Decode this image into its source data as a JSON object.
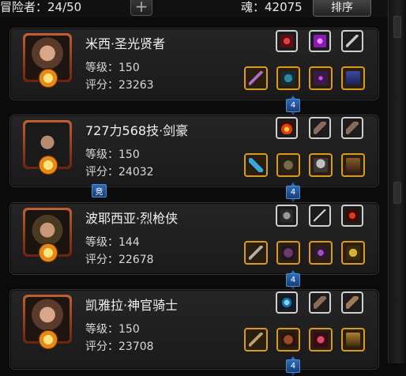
{
  "header": {
    "adventurers_label": "冒险者：24/50",
    "add_symbol": "+",
    "soul_label": "魂：42075",
    "sort_button": "排序"
  },
  "colors": {
    "gold_border": "#d99a1e",
    "white_border": "#cfcfcf",
    "badge_blue": "#2c6ab8"
  },
  "characters": [
    {
      "name": "米西·圣光贤者",
      "level": "等级：150",
      "score": "评分：23263",
      "badge": "4",
      "equipment": [
        {
          "icon": "necklace-icon",
          "frame": "white"
        },
        {
          "icon": "purple-orb-icon",
          "frame": "white"
        },
        {
          "icon": "dagger-icon",
          "frame": "white"
        },
        {
          "icon": "staff-icon",
          "frame": "gold"
        },
        {
          "icon": "armor-icon",
          "frame": "gold"
        },
        {
          "icon": "wand-icon",
          "frame": "gold"
        },
        {
          "icon": "robe-icon",
          "frame": "gold"
        }
      ]
    },
    {
      "name": "727力568技·剑豪",
      "level": "等级：150",
      "score": "评分：24032",
      "badge": "4",
      "extra_badge": "竞",
      "equipment": [
        {
          "icon": "flame-icon",
          "frame": "white"
        },
        {
          "icon": "feather-icon",
          "frame": "white"
        },
        {
          "icon": "feather-icon",
          "frame": "white"
        },
        {
          "icon": "sword-icon",
          "frame": "gold"
        },
        {
          "icon": "armor-icon",
          "frame": "gold"
        },
        {
          "icon": "helmet-icon",
          "frame": "gold"
        },
        {
          "icon": "boots-icon",
          "frame": "gold"
        }
      ]
    },
    {
      "name": "波耶西亚·烈枪侠",
      "level": "等级：144",
      "score": "评分：22678",
      "badge": "4",
      "equipment": [
        {
          "icon": "glove-icon",
          "frame": "white"
        },
        {
          "icon": "spear-icon",
          "frame": "white"
        },
        {
          "icon": "trident-icon",
          "frame": "white"
        },
        {
          "icon": "lance-icon",
          "frame": "gold"
        },
        {
          "icon": "armor-icon",
          "frame": "gold"
        },
        {
          "icon": "amulet-icon",
          "frame": "gold"
        },
        {
          "icon": "ring-icon",
          "frame": "gold"
        }
      ]
    },
    {
      "name": "凯雅拉·神官骑士",
      "level": "等级：150",
      "score": "评分：23708",
      "badge": "4",
      "equipment": [
        {
          "icon": "blue-orb-icon",
          "frame": "white"
        },
        {
          "icon": "feather-icon",
          "frame": "white"
        },
        {
          "icon": "horn-icon",
          "frame": "white"
        },
        {
          "icon": "mace-icon",
          "frame": "gold"
        },
        {
          "icon": "armor-icon",
          "frame": "gold"
        },
        {
          "icon": "potion-icon",
          "frame": "gold"
        },
        {
          "icon": "boots-icon",
          "frame": "gold"
        }
      ]
    }
  ]
}
